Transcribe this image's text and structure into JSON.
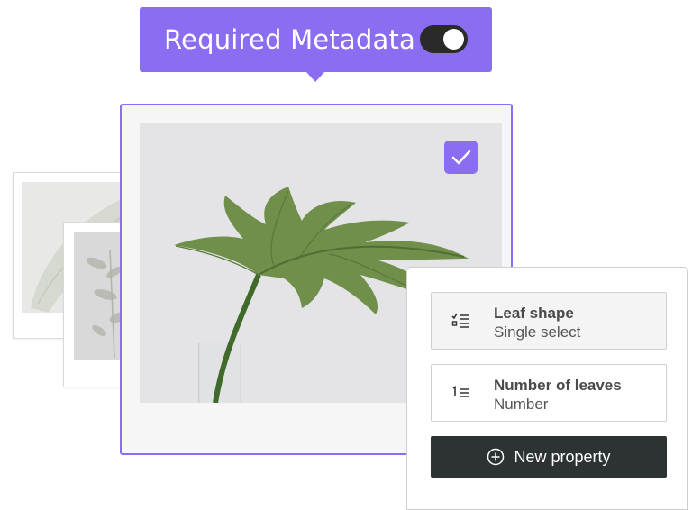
{
  "banner": {
    "title": "Required Metadata",
    "toggle_on": true
  },
  "image_card": {
    "selected": true
  },
  "properties": [
    {
      "label": "Leaf shape",
      "type": "Single select",
      "icon": "checklist-icon"
    },
    {
      "label": "Number of leaves",
      "type": "Number",
      "icon": "numbered-list-icon"
    }
  ],
  "actions": {
    "new_property_label": "New property",
    "new_property_icon": "plus-circle-icon"
  },
  "colors": {
    "accent": "#8b6df2",
    "dark_button": "#2d3233",
    "toggle": "#2a2a2a"
  }
}
